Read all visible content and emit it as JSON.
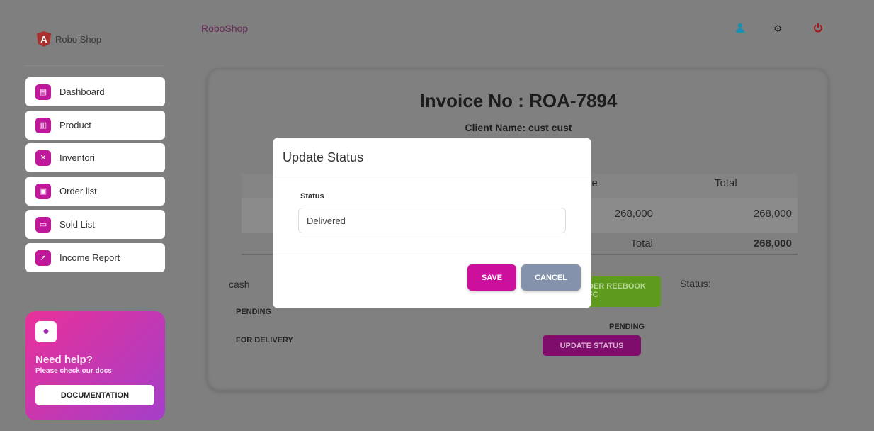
{
  "sidebar": {
    "logo_text": "Robo Shop",
    "logo_letter": "A",
    "items": [
      {
        "label": "Dashboard",
        "icon": "store-icon"
      },
      {
        "label": "Product",
        "icon": "chart-icon"
      },
      {
        "label": "Inventori",
        "icon": "tools-icon"
      },
      {
        "label": "Order list",
        "icon": "document-icon"
      },
      {
        "label": "Sold List",
        "icon": "card-icon"
      },
      {
        "label": "Income Report",
        "icon": "rocket-icon"
      }
    ],
    "help": {
      "title": "Need help?",
      "subtitle": "Please check our docs",
      "button": "DOCUMENTATION"
    }
  },
  "header": {
    "brand": "RoboShop",
    "icons": [
      "user-icon",
      "gear-icon",
      "power-icon"
    ],
    "colors": {
      "user": "#1a8fb0",
      "power": "#a01818"
    }
  },
  "invoice": {
    "title": "Invoice No : ROA-7894",
    "client": "Client Name: cust cust",
    "table": {
      "headers": [
        "ce",
        "Total"
      ],
      "row": [
        "268,000",
        "268,000"
      ],
      "footer": [
        "Total",
        "268,000"
      ]
    },
    "payment": "cash",
    "status_label": "Status:",
    "pending_left": "PENDING",
    "delivery": "FOR DELIVERY",
    "green_button": [
      "DER REEBOOK",
      "FC"
    ],
    "pending_right": "PENDING",
    "update_button": "UPDATE STATUS"
  },
  "modal": {
    "title": "Update Status",
    "field_label": "Status",
    "field_value": "Delivered",
    "save": "SAVE",
    "cancel": "CANCEL"
  },
  "colors": {
    "accent": "#c0189b",
    "save": "#cc0f9c",
    "cancel": "#8493ab"
  }
}
